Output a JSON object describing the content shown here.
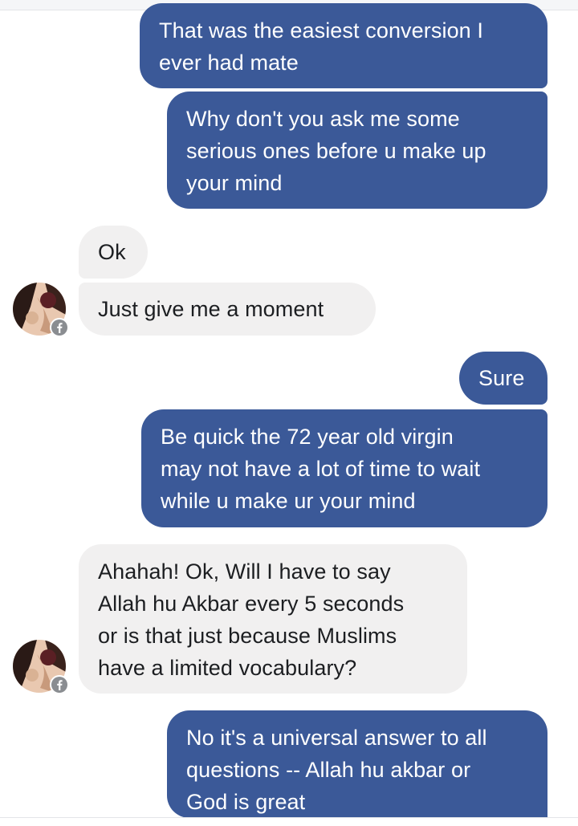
{
  "messages": [
    {
      "sender": "me",
      "text": "That was the easiest conversion I\never had mate"
    },
    {
      "sender": "me",
      "text": "Why don't you ask me some\nserious ones before u make up\nyour mind"
    },
    {
      "sender": "them",
      "text": "Ok"
    },
    {
      "sender": "them",
      "text": "Just give me a moment"
    },
    {
      "sender": "me",
      "text": "Sure"
    },
    {
      "sender": "me",
      "text": "Be quick the 72 year old virgin\nmay not have a lot of time to wait\nwhile u make ur your mind"
    },
    {
      "sender": "them",
      "text": "Ahahah! Ok, Will I have to say\nAllah hu Akbar every 5 seconds\nor is that just because Muslims\nhave a limited vocabulary?"
    },
    {
      "sender": "me",
      "text": "No it's a universal answer to all\nquestions -- Allah hu akbar or\nGod is great"
    }
  ],
  "colors": {
    "outgoing_bubble": "#3b5998",
    "incoming_bubble": "#f1f0f0",
    "incoming_text": "#1c1e21",
    "badge": "#8a8d91"
  },
  "icons": {
    "contact_avatar": "contact-avatar",
    "badge": "facebook-badge-icon"
  }
}
